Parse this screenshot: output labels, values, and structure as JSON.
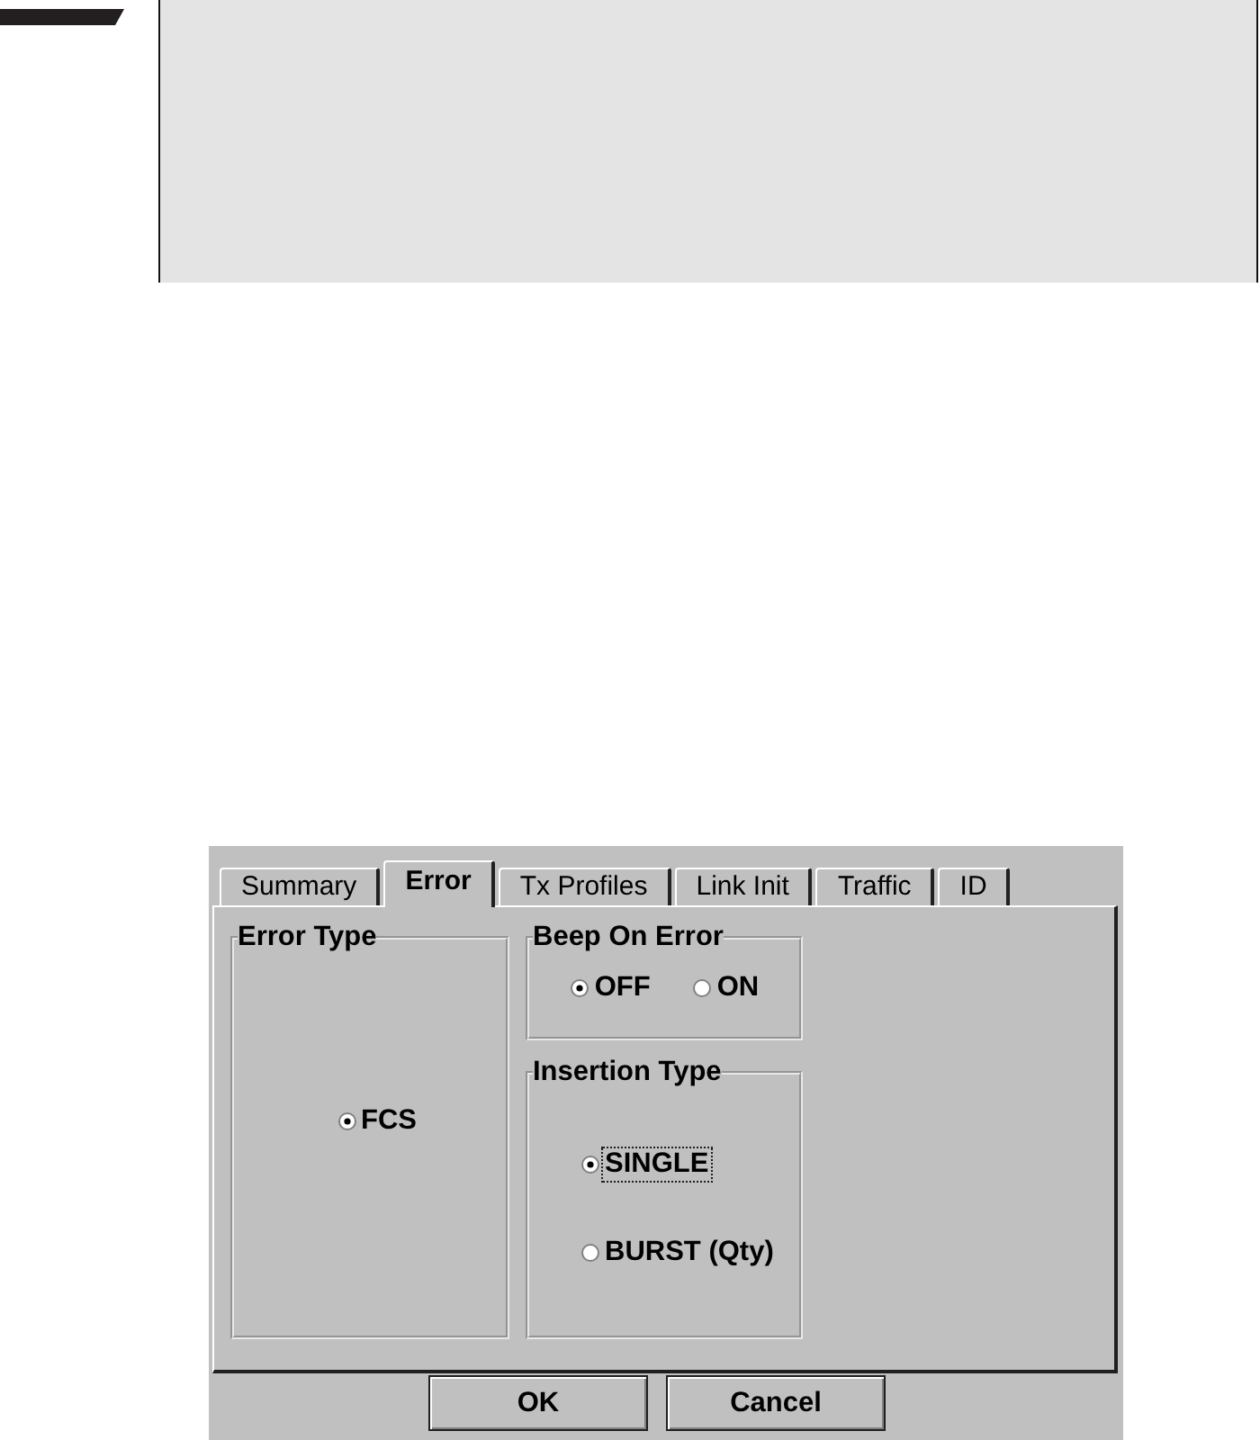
{
  "dialog": {
    "tabs": [
      {
        "label": "Summary",
        "selected": false
      },
      {
        "label": "Error",
        "selected": true
      },
      {
        "label": "Tx Profiles",
        "selected": false
      },
      {
        "label": "Link Init",
        "selected": false
      },
      {
        "label": "Traffic",
        "selected": false
      },
      {
        "label": "ID",
        "selected": false
      }
    ],
    "groups": [
      {
        "title": "Error Type",
        "kind": "center",
        "options": [
          {
            "label": "FCS",
            "selected": true,
            "focused": false
          }
        ]
      },
      {
        "title": "Beep On Error",
        "kind": "row",
        "options": [
          {
            "label": "OFF",
            "selected": true,
            "focused": false
          },
          {
            "label": "ON",
            "selected": false,
            "focused": false
          }
        ]
      },
      {
        "title": "Insertion Type",
        "kind": "column",
        "options": [
          {
            "label": "SINGLE",
            "selected": true,
            "focused": true
          },
          {
            "label": "BURST (Qty)",
            "selected": false,
            "focused": false
          }
        ]
      }
    ],
    "buttons": [
      {
        "label": "OK"
      },
      {
        "label": "Cancel"
      }
    ]
  }
}
